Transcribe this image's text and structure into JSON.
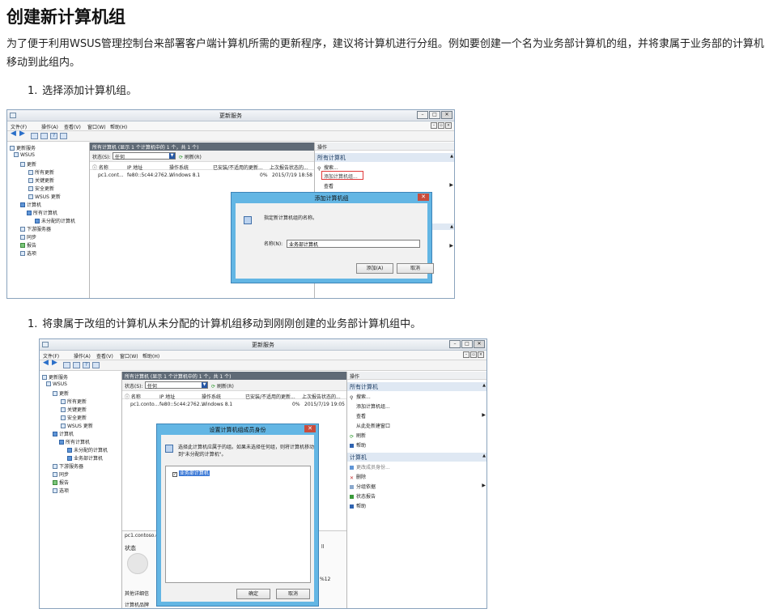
{
  "doc": {
    "title": "创建新计算机组",
    "intro": "为了便于利用WSUS管理控制台来部署客户端计算机所需的更新程序，建议将计算机进行分组。例如要创建一个名为业务部计算机的组，并将隶属于业务部的计算机移动到此组内。",
    "step1": {
      "num": "1.",
      "text": "选择添加计算机组。"
    },
    "step2": {
      "num": "1.",
      "text": "将隶属于改组的计算机从未分配的计算机组移动到刚刚创建的业务部计算机组中。"
    }
  },
  "shot1": {
    "window_title": "更新服务",
    "menu": [
      "文件(F)",
      "操作(A)",
      "查看(V)",
      "窗口(W)",
      "帮助(H)"
    ],
    "tree": [
      "更新服务",
      "WSUS",
      "更新",
      "所有更新",
      "关键更新",
      "安全更新",
      "WSUS 更新",
      "计算机",
      "所有计算机",
      "未分配的计算机",
      "下游服务器",
      "同步",
      "报告",
      "选项"
    ],
    "header": "所有计算机  (显示 1 个计算机中的 1 个，共 1 个)",
    "status_label": "状态(S):",
    "status_value": "任何",
    "refresh": "刷新(R)",
    "columns": [
      "名称",
      "IP 地址",
      "操作系统",
      "已安装/不适用的更新...",
      "上次报告状态的..."
    ],
    "row": [
      "pc1.cont...",
      "fe80::5c44:2762...",
      "Windows 8.1",
      "0%",
      "2015/7/19 18:58"
    ],
    "actions_header": "操作",
    "actions_section": "所有计算机",
    "actions_items": [
      "搜索...",
      "添加计算机组...",
      "查看"
    ],
    "dialog": {
      "title": "添加计算机组",
      "prompt": "指定新计算机组的名称。",
      "name_label": "名称(N):",
      "name_value": "业务部计算机",
      "ok": "添加(A)",
      "cancel": "取消"
    }
  },
  "shot2": {
    "window_title": "更新服务",
    "menu": [
      "文件(F)",
      "操作(A)",
      "查看(V)",
      "窗口(W)",
      "帮助(H)"
    ],
    "tree": [
      "更新服务",
      "WSUS",
      "更新",
      "所有更新",
      "关键更新",
      "安全更新",
      "WSUS 更新",
      "计算机",
      "所有计算机",
      "未分配的计算机",
      "业务部计算机",
      "下游服务器",
      "同步",
      "报告",
      "选项"
    ],
    "header": "所有计算机  (显示 1 个计算机中的 1 个，共 1 个)",
    "status_label": "状态(S):",
    "status_value": "任何",
    "refresh": "刷新(R)",
    "columns": [
      "名称",
      "IP 地址",
      "操作系统",
      "已安装/不适用的更新...",
      "上次报告状态的..."
    ],
    "row": [
      "pc1.conto...",
      "fe80::5c44:2762...",
      "Windows 8.1",
      "0%",
      "2015/7/19 19:05"
    ],
    "detail_name": "pc1.contoso.c",
    "detail_status": "状态",
    "detail_other": "其他详细信",
    "detail_product": "计算机品牌",
    "detail_r": "ll",
    "detail_pct": "%12",
    "actions_header": "操作",
    "actions_section1": "所有计算机",
    "actions_items1": [
      "搜索...",
      "添加计算机组...",
      "查看",
      "从此处新建窗口",
      "刷新",
      "帮助"
    ],
    "actions_section2": "计算机",
    "actions_items2": [
      "更改成员身份...",
      "删除",
      "分组依据",
      "状态报告",
      "帮助"
    ],
    "dialog": {
      "title": "设置计算机组成员身份",
      "prompt": "选择此计算机应属于的组。如果未选择任何组，则将计算机移动到\"未分配的计算机\"。",
      "group": "业务部计算机",
      "ok": "确定",
      "cancel": "取消"
    }
  }
}
